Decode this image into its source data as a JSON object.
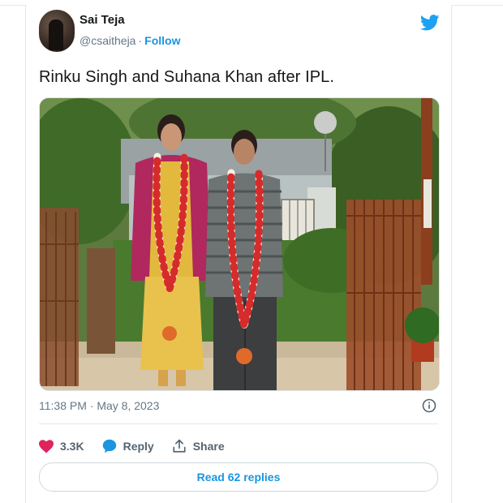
{
  "tweet": {
    "author_name": "Sai Teja",
    "author_handle": "@csaitheja",
    "separator": "·",
    "follow_label": "Follow",
    "text": "Rinku Singh and Suhana Khan after IPL.",
    "timestamp": "11:38 PM · May 8, 2023",
    "likes": "3.3K",
    "reply_label": "Reply",
    "share_label": "Share",
    "read_replies_label": "Read 62 replies"
  },
  "icons": {
    "brand": "twitter-bird-icon",
    "info": "info-icon",
    "like": "heart-icon",
    "reply": "speech-bubble-icon",
    "share": "share-icon"
  },
  "colors": {
    "accent": "#1b95e0",
    "like": "#e0245e",
    "text": "#14171a",
    "muted": "#657786"
  }
}
